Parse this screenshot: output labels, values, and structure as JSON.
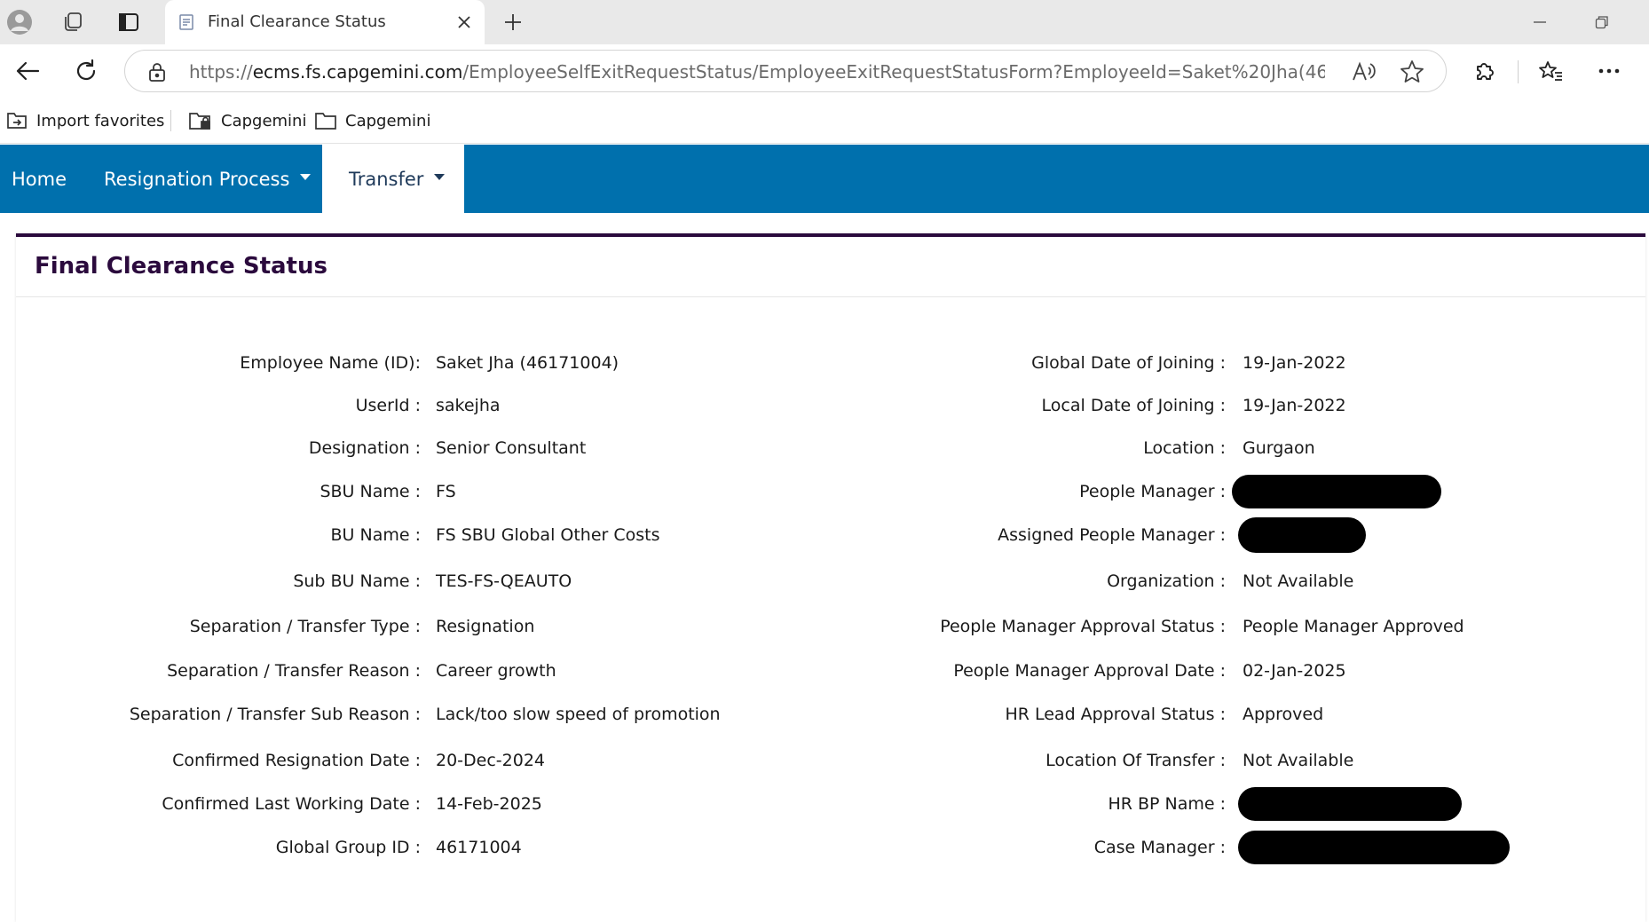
{
  "browser": {
    "tab_title": "Final Clearance Status",
    "url_prefix": "https://",
    "url_host": "ecms.fs.capgemini.com",
    "url_path": "/EmployeeSelfExitRequestStatus/EmployeeExitRequestStatusForm?EmployeeId=Saket%20Jha(46171004)%...",
    "favorites": [
      {
        "label": "Import favorites"
      },
      {
        "label": "Capgemini"
      },
      {
        "label": "Capgemini"
      }
    ]
  },
  "nav": {
    "home": "Home",
    "resignation": "Resignation Process",
    "transfer": "Transfer"
  },
  "page": {
    "title": "Final Clearance Status"
  },
  "left_fields": [
    {
      "label": "Employee Name (ID):",
      "value": "Saket Jha (46171004)"
    },
    {
      "label": "UserId :",
      "value": "sakejha"
    },
    {
      "label": "Designation :",
      "value": "Senior Consultant"
    },
    {
      "label": "SBU Name :",
      "value": "FS"
    },
    {
      "label": "BU Name :",
      "value": "FS SBU Global Other Costs"
    },
    {
      "label": "Sub BU Name :",
      "value": "TES-FS-QEAUTO"
    },
    {
      "label": "Separation / Transfer Type :",
      "value": "Resignation"
    },
    {
      "label": "Separation / Transfer Reason :",
      "value": "Career growth"
    },
    {
      "label": "Separation / Transfer Sub Reason :",
      "value": "Lack/too slow  speed of promotion"
    },
    {
      "label": "Confirmed Resignation Date :",
      "value": "20-Dec-2024"
    },
    {
      "label": "Confirmed Last Working Date :",
      "value": "14-Feb-2025"
    },
    {
      "label": "Global Group ID :",
      "value": "46171004"
    }
  ],
  "right_fields": [
    {
      "label": "Global Date of Joining :",
      "value": "19-Jan-2022"
    },
    {
      "label": "Local Date of Joining :",
      "value": "19-Jan-2022"
    },
    {
      "label": "Location :",
      "value": "Gurgaon"
    },
    {
      "label": "People Manager :",
      "value": ""
    },
    {
      "label": "Assigned People Manager :",
      "value": ""
    },
    {
      "label": "Organization :",
      "value": "Not Available"
    },
    {
      "label": "People Manager Approval Status :",
      "value": "People Manager Approved"
    },
    {
      "label": "People Manager Approval Date :",
      "value": "02-Jan-2025"
    },
    {
      "label": "HR Lead Approval Status :",
      "value": "Approved"
    },
    {
      "label": "Location Of Transfer :",
      "value": "Not Available"
    },
    {
      "label": "HR BP Name :",
      "value": ""
    },
    {
      "label": "Case Manager :",
      "value": ""
    }
  ]
}
